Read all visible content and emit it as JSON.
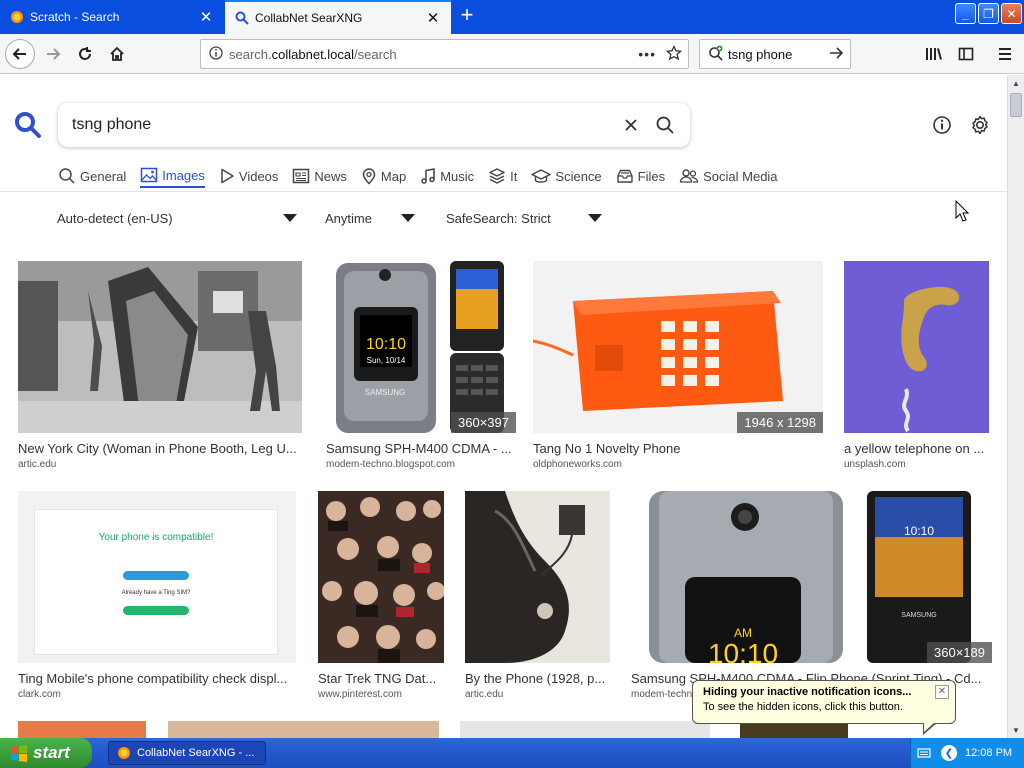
{
  "browser": {
    "tabs": [
      {
        "label": "Scratch - Search",
        "active": false
      },
      {
        "label": "CollabNet SearXNG",
        "active": true
      }
    ],
    "url_prefix": "search.",
    "url_domain": "collabnet.local",
    "url_path": "/search",
    "search_field": "tsng phone",
    "page_actions": "•••"
  },
  "search": {
    "query": "tsng phone"
  },
  "categories": [
    {
      "label": "General",
      "icon": "search-icon",
      "active": false
    },
    {
      "label": "Images",
      "icon": "image-icon",
      "active": true
    },
    {
      "label": "Videos",
      "icon": "play-icon",
      "active": false
    },
    {
      "label": "News",
      "icon": "newspaper-icon",
      "active": false
    },
    {
      "label": "Map",
      "icon": "map-pin-icon",
      "active": false
    },
    {
      "label": "Music",
      "icon": "music-icon",
      "active": false
    },
    {
      "label": "It",
      "icon": "layers-icon",
      "active": false
    },
    {
      "label": "Science",
      "icon": "graduation-cap-icon",
      "active": false
    },
    {
      "label": "Files",
      "icon": "drawer-icon",
      "active": false
    },
    {
      "label": "Social Media",
      "icon": "people-icon",
      "active": false
    }
  ],
  "filters": {
    "language": "Auto-detect (en-US)",
    "time": "Anytime",
    "safesearch": "SafeSearch: Strict"
  },
  "results": [
    {
      "title": "New York City (Woman in Phone Booth, Leg U...",
      "source": "artic.edu",
      "size": ""
    },
    {
      "title": "Samsung SPH-M400 CDMA - ...",
      "source": "modem-techno.blogspot.com",
      "size": "360×397"
    },
    {
      "title": "Tang No 1 Novelty Phone",
      "source": "oldphoneworks.com",
      "size": "1946 x 1298"
    },
    {
      "title": "a yellow telephone on ...",
      "source": "unsplash.com",
      "size": ""
    },
    {
      "title": "Ting Mobile's phone compatibility check displ...",
      "source": "clark.com",
      "size": ""
    },
    {
      "title": "Star Trek TNG Dat...",
      "source": "www.pinterest.com",
      "size": ""
    },
    {
      "title": "By the Phone (1928, p...",
      "source": "artic.edu",
      "size": ""
    },
    {
      "title": "Samsung SPH-M400 CDMA - Flip Phone (Sprint Ting) - Cd...",
      "source": "modem-techno",
      "size": "360×189"
    }
  ],
  "ting_page": {
    "heading": "Your phone is compatible!",
    "sub": "Already have a Ting SIM?"
  },
  "notification": {
    "title": "Hiding your inactive notification icons...",
    "text": "To see the hidden icons, click this button."
  },
  "taskbar": {
    "start": "start",
    "task": "CollabNet SearXNG - ...",
    "clock": "12:08 PM"
  },
  "colors": {
    "accent": "#3050d0",
    "titlebar": "#0a4ee0",
    "start_green": "#3a9e3a"
  }
}
